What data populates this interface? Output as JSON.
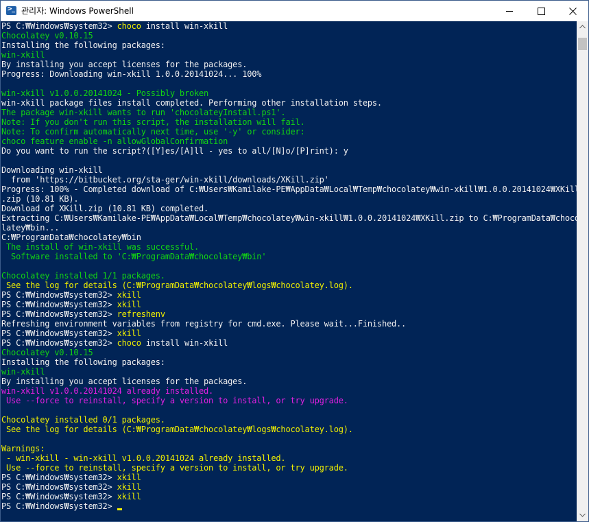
{
  "window": {
    "title": "관리자: Windows PowerShell",
    "app_icon": "powershell-icon",
    "controls": [
      "minimize-icon",
      "maximize-icon",
      "close-icon"
    ]
  },
  "colors": {
    "background": "#012456",
    "text": "#f0f0f0",
    "command": "#f0f000",
    "success": "#13d313",
    "warning": "#f0f000",
    "error": "#e020e0"
  },
  "console": {
    "lines": [
      [
        {
          "t": "PS C:₩Windows₩system32> ",
          "c": "white"
        },
        {
          "t": "choco",
          "c": "yellow"
        },
        {
          "t": " install win-xkill",
          "c": "white"
        }
      ],
      [
        {
          "t": "Chocolatey v0.10.15",
          "c": "green"
        }
      ],
      [
        {
          "t": "Installing the following packages:",
          "c": "white"
        }
      ],
      [
        {
          "t": "win-xkill",
          "c": "green"
        }
      ],
      [
        {
          "t": "By installing you accept licenses for the packages.",
          "c": "white"
        }
      ],
      [
        {
          "t": "Progress: Downloading win-xkill 1.0.0.20141024... 100%",
          "c": "white"
        }
      ],
      [
        {
          "t": "",
          "c": "white"
        }
      ],
      [
        {
          "t": "win-xkill v1.0.0.20141024 - Possibly broken",
          "c": "green"
        }
      ],
      [
        {
          "t": "win-xkill package files install completed. Performing other installation steps.",
          "c": "white"
        }
      ],
      [
        {
          "t": "The package win-xkill wants to run 'chocolateyInstall.ps1'.",
          "c": "green"
        }
      ],
      [
        {
          "t": "Note: If you don't run this script, the installation will fail.",
          "c": "green"
        }
      ],
      [
        {
          "t": "Note: To confirm automatically next time, use '-y' or consider:",
          "c": "green"
        }
      ],
      [
        {
          "t": "choco feature enable -n allowGlobalConfirmation",
          "c": "green"
        }
      ],
      [
        {
          "t": "Do you want to run the script?([Y]es/[A]ll - yes to all/[N]o/[P]rint): y",
          "c": "white"
        }
      ],
      [
        {
          "t": "",
          "c": "white"
        }
      ],
      [
        {
          "t": "Downloading win-xkill",
          "c": "white"
        }
      ],
      [
        {
          "t": "  from 'https://bitbucket.org/sta-ger/win-xkill/downloads/XKill.zip'",
          "c": "white"
        }
      ],
      [
        {
          "t": "Progress: 100% - Completed download of C:₩Users₩Kamilake-PE₩AppData₩Local₩Temp₩chocolatey₩win-xkill₩1.0.0.20141024₩XKill",
          "c": "white"
        }
      ],
      [
        {
          "t": ".zip (10.81 KB).",
          "c": "white"
        }
      ],
      [
        {
          "t": "Download of XKill.zip (10.81 KB) completed.",
          "c": "white"
        }
      ],
      [
        {
          "t": "Extracting C:₩Users₩Kamilake-PE₩AppData₩Local₩Temp₩chocolatey₩win-xkill₩1.0.0.20141024₩XKill.zip to C:₩ProgramData₩choco",
          "c": "white"
        }
      ],
      [
        {
          "t": "latey₩bin...",
          "c": "white"
        }
      ],
      [
        {
          "t": "C:₩ProgramData₩chocolatey₩bin",
          "c": "white"
        }
      ],
      [
        {
          "t": " The install of win-xkill was successful.",
          "c": "green"
        }
      ],
      [
        {
          "t": "  Software installed to 'C:₩ProgramData₩chocolatey₩bin'",
          "c": "green"
        }
      ],
      [
        {
          "t": "",
          "c": "white"
        }
      ],
      [
        {
          "t": "Chocolatey installed 1/1 packages.",
          "c": "green"
        }
      ],
      [
        {
          "t": " See the log for details (C:₩ProgramData₩chocolatey₩logs₩chocolatey.log).",
          "c": "yellow"
        }
      ],
      [
        {
          "t": "PS C:₩Windows₩system32> ",
          "c": "white"
        },
        {
          "t": "xkill",
          "c": "yellow"
        }
      ],
      [
        {
          "t": "PS C:₩Windows₩system32> ",
          "c": "white"
        },
        {
          "t": "xkill",
          "c": "yellow"
        }
      ],
      [
        {
          "t": "PS C:₩Windows₩system32> ",
          "c": "white"
        },
        {
          "t": "refreshenv",
          "c": "yellow"
        }
      ],
      [
        {
          "t": "Refreshing environment variables from registry for cmd.exe. Please wait...Finished..",
          "c": "white"
        }
      ],
      [
        {
          "t": "PS C:₩Windows₩system32> ",
          "c": "white"
        },
        {
          "t": "xkill",
          "c": "yellow"
        }
      ],
      [
        {
          "t": "PS C:₩Windows₩system32> ",
          "c": "white"
        },
        {
          "t": "choco",
          "c": "yellow"
        },
        {
          "t": " install win-xkill",
          "c": "white"
        }
      ],
      [
        {
          "t": "Chocolatey v0.10.15",
          "c": "green"
        }
      ],
      [
        {
          "t": "Installing the following packages:",
          "c": "white"
        }
      ],
      [
        {
          "t": "win-xkill",
          "c": "green"
        }
      ],
      [
        {
          "t": "By installing you accept licenses for the packages.",
          "c": "white"
        }
      ],
      [
        {
          "t": "win-xkill v1.0.0.20141024 already installed.",
          "c": "magenta"
        }
      ],
      [
        {
          "t": " Use --force to reinstall, specify a version to install, or try upgrade.",
          "c": "magenta"
        }
      ],
      [
        {
          "t": "",
          "c": "white"
        }
      ],
      [
        {
          "t": "Chocolatey installed 0/1 packages.",
          "c": "yellow"
        }
      ],
      [
        {
          "t": " See the log for details (C:₩ProgramData₩chocolatey₩logs₩chocolatey.log).",
          "c": "yellow"
        }
      ],
      [
        {
          "t": "",
          "c": "white"
        }
      ],
      [
        {
          "t": "Warnings:",
          "c": "yellow"
        }
      ],
      [
        {
          "t": " - win-xkill - win-xkill v1.0.0.20141024 already installed.",
          "c": "yellow"
        }
      ],
      [
        {
          "t": " Use --force to reinstall, specify a version to install, or try upgrade.",
          "c": "yellow"
        }
      ],
      [
        {
          "t": "PS C:₩Windows₩system32> ",
          "c": "white"
        },
        {
          "t": "xkill",
          "c": "yellow"
        }
      ],
      [
        {
          "t": "PS C:₩Windows₩system32> ",
          "c": "white"
        },
        {
          "t": "xkill",
          "c": "yellow"
        }
      ],
      [
        {
          "t": "PS C:₩Windows₩system32> ",
          "c": "white"
        },
        {
          "t": "xkill",
          "c": "yellow"
        }
      ],
      [
        {
          "t": "PS C:₩Windows₩system32> ",
          "c": "white"
        }
      ]
    ],
    "cursor": true
  }
}
